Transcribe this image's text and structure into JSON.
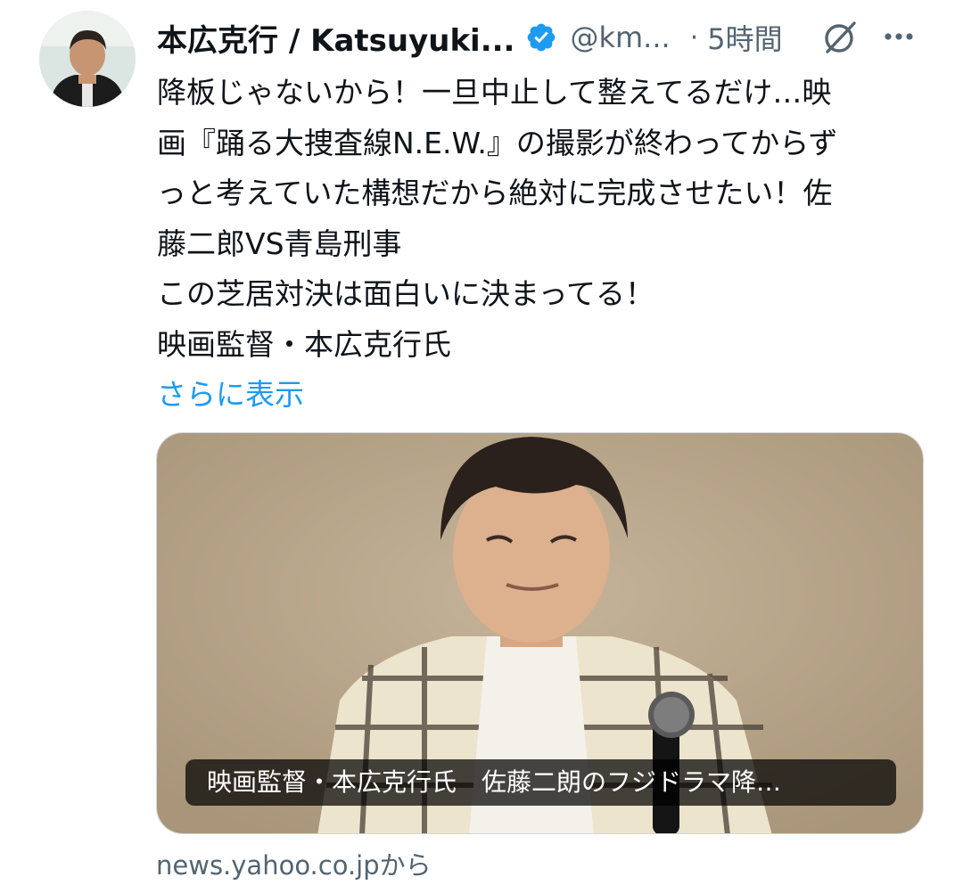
{
  "tweet": {
    "author": {
      "display_name": "本広克行 / Katsuyuki...",
      "verified": true,
      "handle": "@km...",
      "avatar_icon": "avatar-photo"
    },
    "separator": "·",
    "time": "5時間",
    "grok_icon": "grok-icon",
    "more_icon": "more-icon",
    "text_lines": [
      "降板じゃないから！一旦中止して整えてるだけ…映",
      "画『踊る大捜査線N.E.W.』の撮影が終わってからず",
      "っと考えていた構想だから絶対に完成させたい！佐",
      "藤二郎VS青島刑事",
      "この芝居対決は面白いに決まってる！",
      "映画監督・本広克行氏"
    ],
    "show_more": "さらに表示",
    "card": {
      "caption": "映画監督・本広克行氏　佐藤二朗のフジドラマ降…",
      "source": "news.yahoo.co.jpから"
    }
  },
  "colors": {
    "text": "#0f1419",
    "secondary": "#536471",
    "link": "#1d9bf0",
    "verified": "#1d9bf0"
  }
}
